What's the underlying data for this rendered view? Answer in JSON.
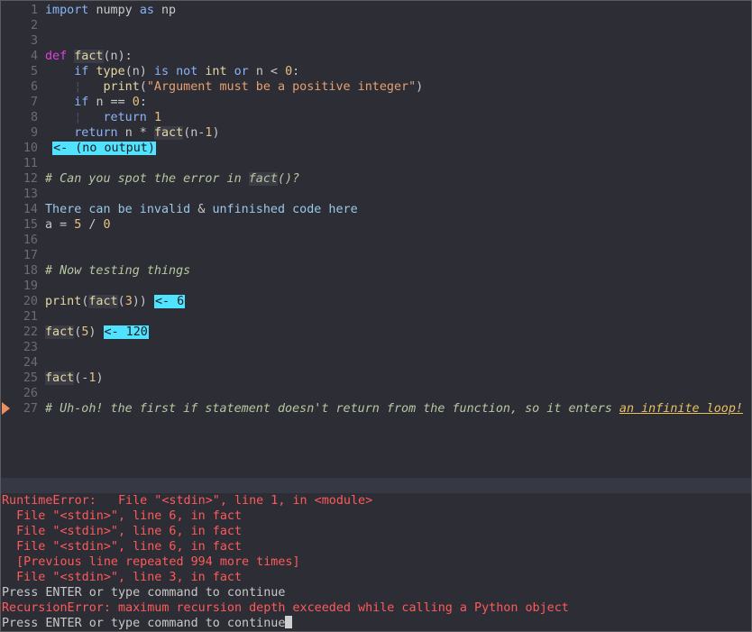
{
  "editor": {
    "lines": [
      {
        "n": "1",
        "segs": [
          {
            "t": "import ",
            "c": "kw2"
          },
          {
            "t": "numpy ",
            "c": "op"
          },
          {
            "t": "as ",
            "c": "kw2"
          },
          {
            "t": "np",
            "c": "op"
          }
        ]
      },
      {
        "n": "2",
        "segs": []
      },
      {
        "n": "3",
        "segs": []
      },
      {
        "n": "4",
        "segs": [
          {
            "t": "def ",
            "c": "kw"
          },
          {
            "t": "fact",
            "c": "fn"
          },
          {
            "t": "(n):",
            "c": "op"
          }
        ]
      },
      {
        "n": "5",
        "segs": [
          {
            "t": "    if ",
            "c": "kw2"
          },
          {
            "t": "type",
            "c": "fn-plain"
          },
          {
            "t": "(n) ",
            "c": "op"
          },
          {
            "t": "is not ",
            "c": "kw2"
          },
          {
            "t": "int ",
            "c": "fn-plain"
          },
          {
            "t": "or ",
            "c": "kw2"
          },
          {
            "t": "n < ",
            "c": "op"
          },
          {
            "t": "0",
            "c": "num"
          },
          {
            "t": ":",
            "c": "op"
          }
        ]
      },
      {
        "n": "6",
        "segs": [
          {
            "t": "    ¦   ",
            "c": "guide"
          },
          {
            "t": "print",
            "c": "fn-plain"
          },
          {
            "t": "(",
            "c": "op"
          },
          {
            "t": "\"Argument must be a positive integer\"",
            "c": "str"
          },
          {
            "t": ")",
            "c": "op"
          }
        ]
      },
      {
        "n": "7",
        "segs": [
          {
            "t": "    if ",
            "c": "kw2"
          },
          {
            "t": "n == ",
            "c": "op"
          },
          {
            "t": "0",
            "c": "num"
          },
          {
            "t": ":",
            "c": "op"
          }
        ]
      },
      {
        "n": "8",
        "segs": [
          {
            "t": "    ¦   ",
            "c": "guide"
          },
          {
            "t": "return ",
            "c": "kw2"
          },
          {
            "t": "1",
            "c": "num"
          }
        ]
      },
      {
        "n": "9",
        "segs": [
          {
            "t": "    return ",
            "c": "kw2"
          },
          {
            "t": "n * ",
            "c": "op"
          },
          {
            "t": "fact",
            "c": "fn"
          },
          {
            "t": "(n-",
            "c": "op"
          },
          {
            "t": "1",
            "c": "num"
          },
          {
            "t": ")",
            "c": "op"
          }
        ]
      },
      {
        "n": "10",
        "segs": [
          {
            "t": " ",
            "c": "op"
          },
          {
            "t": "<- (no output)",
            "c": "out"
          }
        ]
      },
      {
        "n": "11",
        "segs": []
      },
      {
        "n": "12",
        "segs": [
          {
            "t": "# Can you spot the error in ",
            "c": "cm"
          },
          {
            "t": "fact",
            "c": "cm cm-fn"
          },
          {
            "t": "()?",
            "c": "cm"
          }
        ]
      },
      {
        "n": "13",
        "segs": []
      },
      {
        "n": "14",
        "segs": [
          {
            "t": "There can be invalid ",
            "c": "txt"
          },
          {
            "t": "& ",
            "c": "op"
          },
          {
            "t": "unfinished code here",
            "c": "txt"
          }
        ]
      },
      {
        "n": "15",
        "segs": [
          {
            "t": "a = ",
            "c": "op"
          },
          {
            "t": "5 ",
            "c": "num"
          },
          {
            "t": "/ ",
            "c": "op"
          },
          {
            "t": "0",
            "c": "num"
          }
        ]
      },
      {
        "n": "16",
        "segs": []
      },
      {
        "n": "17",
        "segs": []
      },
      {
        "n": "18",
        "segs": [
          {
            "t": "# Now testing things",
            "c": "cm"
          }
        ]
      },
      {
        "n": "19",
        "segs": []
      },
      {
        "n": "20",
        "segs": [
          {
            "t": "print",
            "c": "fn-plain"
          },
          {
            "t": "(",
            "c": "op"
          },
          {
            "t": "fact",
            "c": "fn"
          },
          {
            "t": "(",
            "c": "op"
          },
          {
            "t": "3",
            "c": "num"
          },
          {
            "t": ")) ",
            "c": "op"
          },
          {
            "t": "<- 6",
            "c": "out"
          }
        ]
      },
      {
        "n": "21",
        "segs": []
      },
      {
        "n": "22",
        "segs": [
          {
            "t": "fact",
            "c": "fn"
          },
          {
            "t": "(",
            "c": "op"
          },
          {
            "t": "5",
            "c": "num"
          },
          {
            "t": ") ",
            "c": "op"
          },
          {
            "t": "<- 120",
            "c": "out"
          }
        ]
      },
      {
        "n": "23",
        "segs": []
      },
      {
        "n": "24",
        "segs": []
      },
      {
        "n": "25",
        "segs": [
          {
            "t": "fact",
            "c": "fn"
          },
          {
            "t": "(-",
            "c": "op"
          },
          {
            "t": "1",
            "c": "num"
          },
          {
            "t": ")",
            "c": "op"
          }
        ]
      },
      {
        "n": "26",
        "segs": []
      },
      {
        "n": "27",
        "segs": [
          {
            "t": "# Uh-oh! the first if statement doesn't return from the function, so it enters ",
            "c": "cm"
          },
          {
            "t": "an infinite loop!",
            "c": "cm cm-link"
          }
        ]
      }
    ],
    "sign_line": 27
  },
  "messages": [
    {
      "t": "RuntimeError:   File \"<stdin>\", line 1, in <module>",
      "c": "err"
    },
    {
      "t": "  File \"<stdin>\", line 6, in fact",
      "c": "err"
    },
    {
      "t": "  File \"<stdin>\", line 6, in fact",
      "c": "err"
    },
    {
      "t": "  File \"<stdin>\", line 6, in fact",
      "c": "err"
    },
    {
      "t": "  [Previous line repeated 994 more times]",
      "c": "err"
    },
    {
      "t": "  File \"<stdin>\", line 3, in fact",
      "c": "err"
    },
    {
      "t": "Press ENTER or type command to continue",
      "c": "norm"
    },
    {
      "t": "RecursionError: maximum recursion depth exceeded while calling a Python object",
      "c": "err"
    },
    {
      "t": "Press ENTER or type command to continue",
      "c": "norm",
      "cursor": true
    }
  ]
}
